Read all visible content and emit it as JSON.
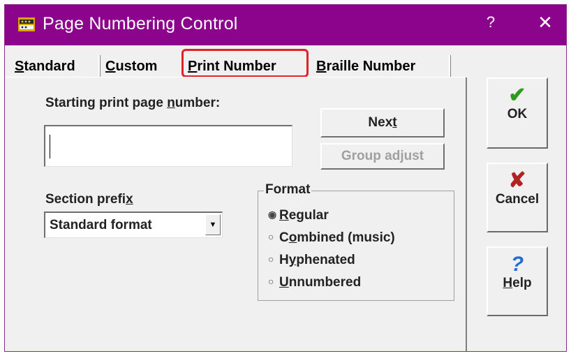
{
  "window": {
    "title": "Page Numbering Control",
    "help_glyph": "?",
    "close_glyph": "✕"
  },
  "tabs": [
    {
      "pre": "",
      "u": "S",
      "post": "tandard"
    },
    {
      "pre": "",
      "u": "C",
      "post": "ustom"
    },
    {
      "pre": "",
      "u": "P",
      "post": "rint Number"
    },
    {
      "pre": "",
      "u": "B",
      "post": "raille Number"
    }
  ],
  "active_tab": "Print Number",
  "starting_label": {
    "pre": "Starting print page ",
    "u": "n",
    "post": "umber:"
  },
  "starting_input_value": "",
  "next_button": {
    "pre": "Nex",
    "u": "t",
    "post": ""
  },
  "group_adjust_button": "Group adjust",
  "section_prefix_label": {
    "pre": "Section prefi",
    "u": "x",
    "post": ""
  },
  "section_prefix_value": "Standard format",
  "dropdown_arrow": "▼",
  "format": {
    "title": "Format",
    "selected_index": 0,
    "options": [
      {
        "pre": "",
        "u": "R",
        "post": "egular"
      },
      {
        "pre": "C",
        "u": "o",
        "post": "mbined (music)"
      },
      {
        "pre": "H",
        "u": "y",
        "post": "phenated"
      },
      {
        "pre": "",
        "u": "U",
        "post": "nnumbered"
      }
    ],
    "radio_on": "◉",
    "radio_off": "○"
  },
  "side_buttons": {
    "ok": {
      "glyph": "✔",
      "label": "OK",
      "glyph_color": "#2e9a1f"
    },
    "cancel": {
      "glyph": "✘",
      "label": "Cancel",
      "glyph_color": "#b22222"
    },
    "help": {
      "glyph": "?",
      "pre": "",
      "u": "H",
      "post": "elp",
      "glyph_color": "#1f6fcf"
    }
  },
  "colors": {
    "titlebar": "#8b048b",
    "highlight_border": "#e0202a"
  }
}
